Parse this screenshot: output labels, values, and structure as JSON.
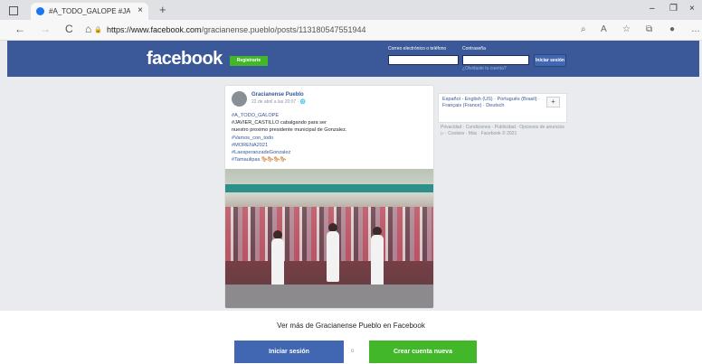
{
  "browser": {
    "tab_title": "#A_TODO_GALOPE #JAVIER_CA",
    "tab_close": "×",
    "new_tab": "+",
    "back": "←",
    "forward": "→",
    "reload": "C",
    "home": "⌂",
    "lock": "🔒",
    "url_host": "https://www.facebook.com",
    "url_path": "/gracianense.pueblo/posts/113180547551944",
    "minimize": "–",
    "maximize": "❐",
    "close": "×",
    "icons": [
      "zoom-icon",
      "reader-icon",
      "favorites-icon",
      "collections-icon",
      "profile-icon",
      "more-icon"
    ]
  },
  "header": {
    "logo": "facebook",
    "register_label": "Registrarte",
    "email_label": "Correo electrónico o teléfono",
    "password_label": "Contraseña",
    "forgot_label": "¿Olvidaste tu cuenta?",
    "login_label": "Iniciar sesión"
  },
  "post": {
    "author": "Gracianense Pueblo",
    "date": "22 de abril a las 20:07 · ",
    "lines": [
      {
        "text": "#A_TODO_GALOPE",
        "tag": true
      },
      {
        "text": "#JAVIER_CASTILLO cabalgando para ser",
        "tag": false
      },
      {
        "text": "nuestro proximo presidente municipal de Gonzalez.",
        "tag": false
      },
      {
        "text": "#Vamos_con_todo",
        "tag": true
      },
      {
        "text": "#MORENA2021",
        "tag": true
      },
      {
        "text": "#LaesperanzadeGonzalez",
        "tag": true
      },
      {
        "text": "#Tamaulipas 🐎🐎🐎🐎",
        "tag": true
      }
    ]
  },
  "sidebar": {
    "languages": "Español · English (US) · Português (Brasil) · Français (France) · Deutsch",
    "add_language": "+",
    "footer": "Privacidad · Condiciones · Publicidad · Opciones de anuncios ▷ · Cookies · Más · Facebook © 2021"
  },
  "bottom": {
    "see_more": "Ver más de Gracianense Pueblo en Facebook",
    "login_label": "Iniciar sesión",
    "or_label": "o",
    "create_label": "Crear cuenta nueva"
  },
  "colors": {
    "brand": "#3b5998",
    "green": "#42b72a",
    "button_blue": "#4267b2"
  }
}
